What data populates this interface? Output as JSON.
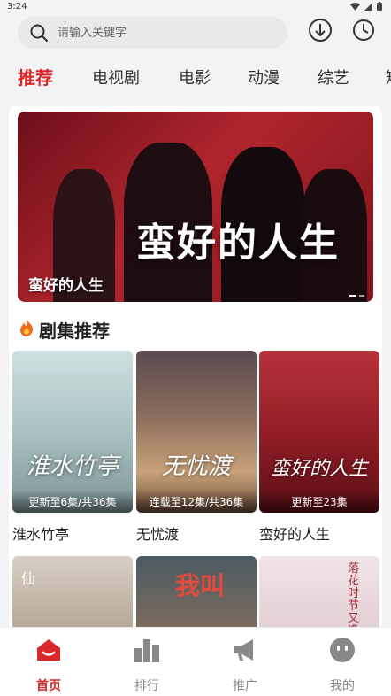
{
  "status_bar": {
    "time": "3:24"
  },
  "search": {
    "placeholder": "请输入关键字"
  },
  "tabs": [
    {
      "label": "推荐",
      "active": true
    },
    {
      "label": "电视剧"
    },
    {
      "label": "电影"
    },
    {
      "label": "动漫"
    },
    {
      "label": "综艺"
    },
    {
      "label": "短"
    }
  ],
  "banner": {
    "art_title": "蛮好的人生",
    "caption": "蛮好的人生"
  },
  "section": {
    "title": "剧集推荐"
  },
  "dramas": [
    {
      "title": "淮水竹亭",
      "art_title": "淮水竹亭",
      "episodes": "更新至6集/共36集"
    },
    {
      "title": "无忧渡",
      "art_title": "无忧渡",
      "episodes": "连载至12集/共36集"
    },
    {
      "title": "蛮好的人生",
      "art_title": "蛮好的人生",
      "episodes": "更新至23集"
    }
  ],
  "row2_art": {
    "left": "仙",
    "middle": "我叫",
    "right": "落花时节又逢君"
  },
  "bottom_nav": [
    {
      "label": "首页",
      "icon": "home-icon",
      "active": true
    },
    {
      "label": "排行",
      "icon": "ranking-bars-icon"
    },
    {
      "label": "推广",
      "icon": "megaphone-icon"
    },
    {
      "label": "我的",
      "icon": "profile-face-icon"
    }
  ],
  "colors": {
    "accent": "#d8282a",
    "background": "#f3f3f5"
  }
}
